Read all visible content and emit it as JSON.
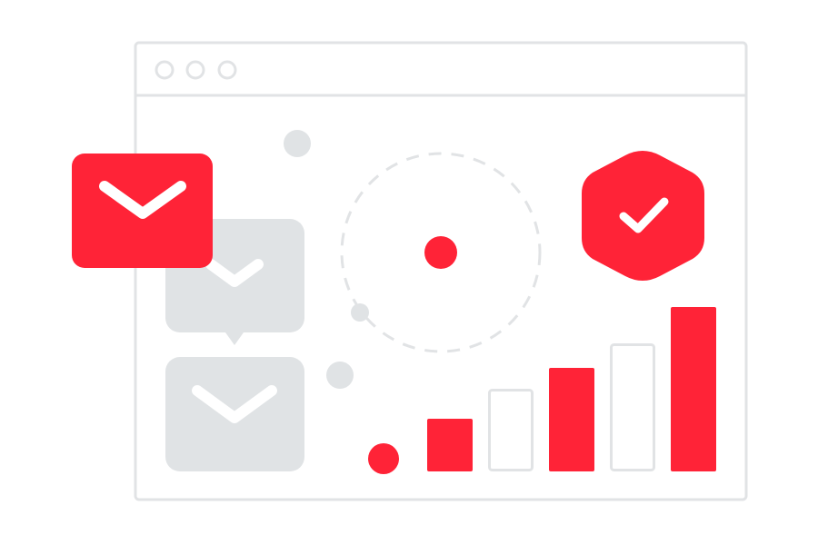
{
  "colors": {
    "accent": "#ff2337",
    "neutral": "#e0e3e5",
    "frame": "#e1e3e5",
    "background": "#ffffff"
  },
  "window": {
    "dots": 3
  },
  "icons": {
    "mail_primary": "envelope-icon",
    "mail_secondary": "envelope-icon",
    "badge": "checkmark-badge-icon",
    "target": "target-circle-icon",
    "chart": "bar-chart-icon"
  },
  "bar_chart": {
    "levels": [
      0.32,
      0.5,
      0.63,
      0.78,
      1.0
    ],
    "filled": [
      true,
      false,
      true,
      false,
      true
    ]
  }
}
